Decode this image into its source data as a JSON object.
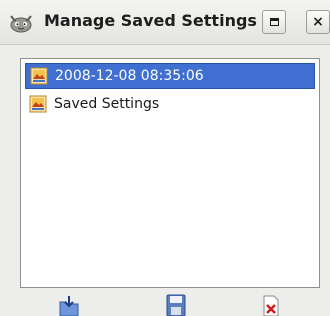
{
  "window": {
    "title": "Manage Saved Settings",
    "app_icon": "gimp-icon",
    "maximize_icon": "maximize-icon",
    "close_label": "×"
  },
  "settings_list": {
    "items": [
      {
        "label": "2008-12-08 08:35:06",
        "icon": "image-settings-icon",
        "selected": true
      },
      {
        "label": "Saved Settings",
        "icon": "image-settings-icon",
        "selected": false
      }
    ]
  },
  "toolbar": {
    "import_icon": "import-icon",
    "export_icon": "save-icon",
    "delete_icon": "delete-icon"
  },
  "colors": {
    "selection": "#3f6fd0",
    "window_bg": "#ededeb"
  }
}
